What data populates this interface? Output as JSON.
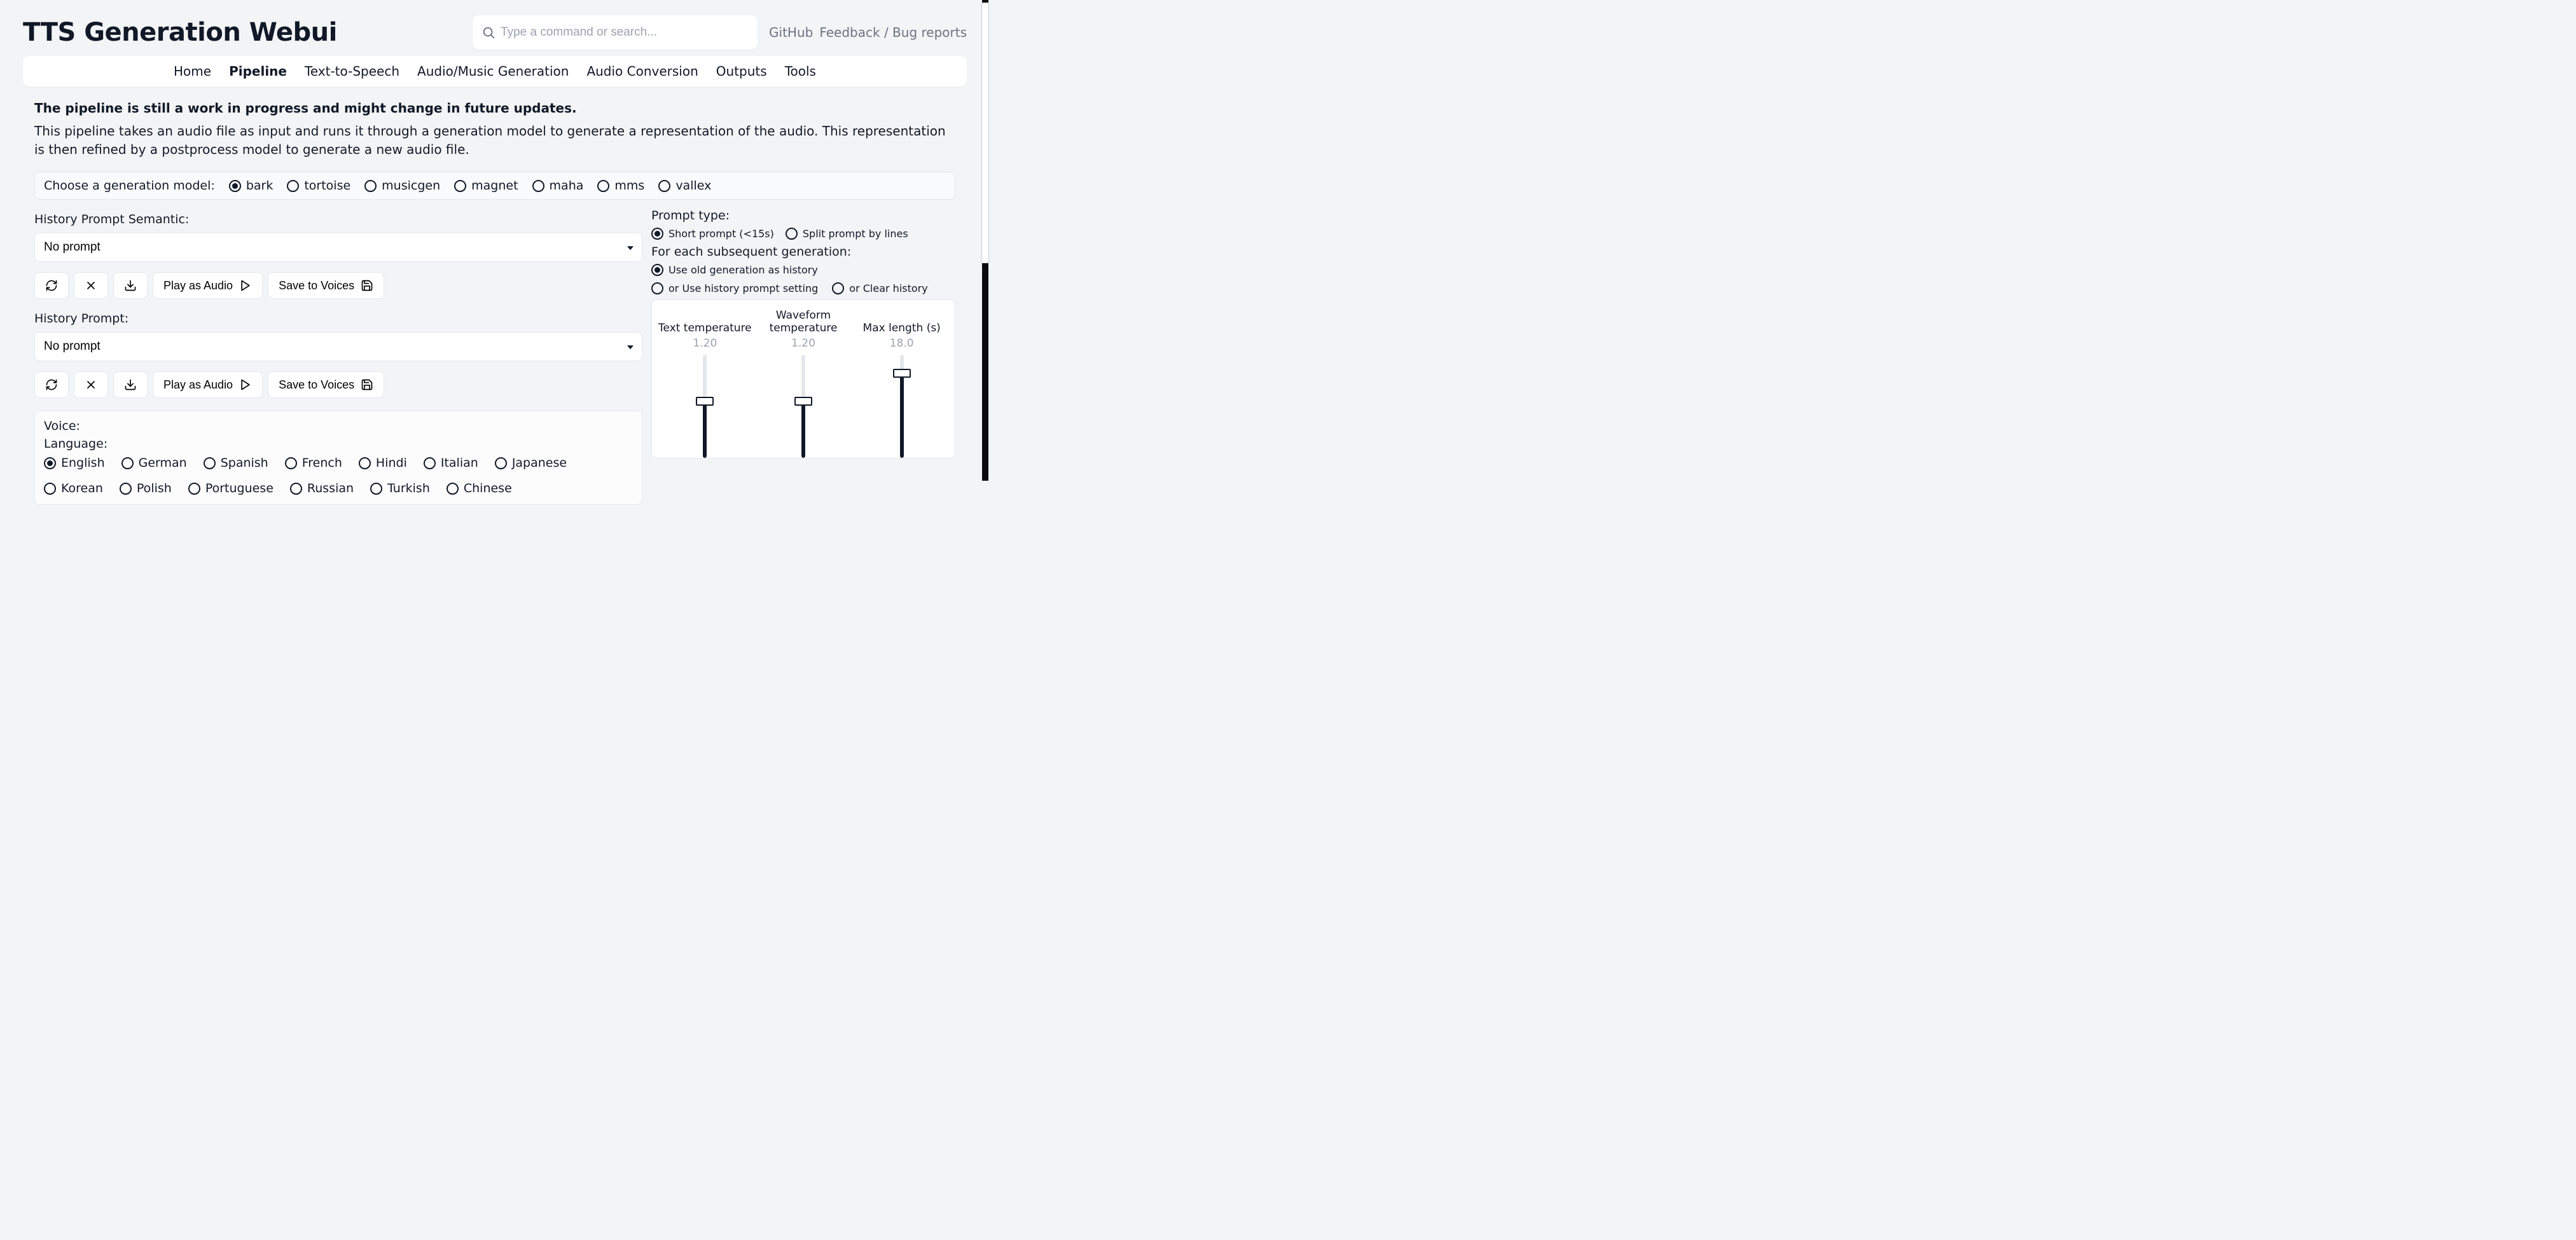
{
  "header": {
    "title": "TTS Generation Webui",
    "search_placeholder": "Type a command or search...",
    "links": [
      "GitHub",
      "Feedback / Bug reports"
    ]
  },
  "nav": {
    "items": [
      "Home",
      "Pipeline",
      "Text-to-Speech",
      "Audio/Music Generation",
      "Audio Conversion",
      "Outputs",
      "Tools"
    ],
    "active": "Pipeline"
  },
  "description": {
    "strong": "The pipeline is still a work in progress and might change in future updates.",
    "body": "This pipeline takes an audio file as input and runs it through a generation model to generate a representation of the audio. This representation is then refined by a postprocess model to generate a new audio file."
  },
  "model_choice": {
    "label": "Choose a generation model:",
    "options": [
      "bark",
      "tortoise",
      "musicgen",
      "magnet",
      "maha",
      "mms",
      "vallex"
    ],
    "selected": "bark"
  },
  "history_prompt_semantic": {
    "label": "History Prompt Semantic:",
    "value": "No prompt",
    "buttons": {
      "play": "Play as Audio",
      "save": "Save to Voices"
    }
  },
  "history_prompt": {
    "label": "History Prompt:",
    "value": "No prompt",
    "buttons": {
      "play": "Play as Audio",
      "save": "Save to Voices"
    }
  },
  "voice_panel": {
    "voice_label": "Voice:",
    "language_label": "Language:",
    "languages": [
      "English",
      "German",
      "Spanish",
      "French",
      "Hindi",
      "Italian",
      "Japanese",
      "Korean",
      "Polish",
      "Portuguese",
      "Russian",
      "Turkish",
      "Chinese"
    ],
    "selected_language": "English"
  },
  "right": {
    "prompt_type_label": "Prompt type:",
    "prompt_type_options": [
      "Short prompt (<15s)",
      "Split prompt by lines"
    ],
    "prompt_type_selected": "Short prompt (<15s)",
    "subsequent_label": "For each subsequent generation:",
    "subsequent_options": [
      "Use old generation as history",
      "or Use history prompt setting",
      "or Clear history"
    ],
    "subsequent_selected": "Use old generation as history",
    "sliders": [
      {
        "title": "Text temperature",
        "value": "1.20",
        "fill_pct": 55
      },
      {
        "title": "Waveform\ntemperature",
        "value": "1.20",
        "fill_pct": 55
      },
      {
        "title": "Max length (s)",
        "value": "18.0",
        "fill_pct": 82
      }
    ]
  }
}
